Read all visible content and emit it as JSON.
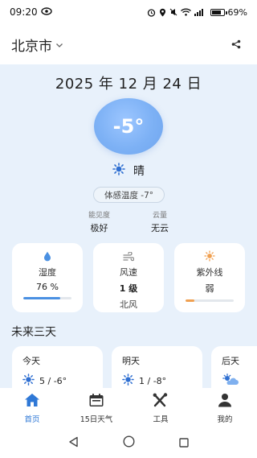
{
  "status_bar": {
    "time": "09:20",
    "battery": "69%",
    "battery_level": 0.69
  },
  "header": {
    "city": "北京市"
  },
  "weather": {
    "date": "2025 年 12 月 24 日",
    "temperature": "-5°",
    "condition": "晴",
    "feels_like": "体感温度 -7°",
    "stats": [
      {
        "label": "能见度",
        "value": "极好"
      },
      {
        "label": "云量",
        "value": "无云"
      }
    ]
  },
  "cards": {
    "humidity": {
      "title": "湿度",
      "value": "76 %",
      "level": 0.76,
      "color": "#4a90e2"
    },
    "wind": {
      "title": "风速",
      "value": "1 级",
      "direction": "北风"
    },
    "uv": {
      "title": "紫外线",
      "value": "弱",
      "level": 0.18,
      "color": "#f0a050"
    }
  },
  "forecast": {
    "title": "未来三天",
    "days": [
      {
        "day": "今天",
        "temp": "5 / -6°",
        "icon": "sun-icon"
      },
      {
        "day": "明天",
        "temp": "1 / -8°",
        "icon": "sun-icon"
      },
      {
        "day": "后天",
        "temp": "",
        "icon": "partly-cloudy-icon"
      }
    ]
  },
  "nav": {
    "items": [
      {
        "label": "首页",
        "icon": "home-icon",
        "active": true
      },
      {
        "label": "15日天气",
        "icon": "calendar-icon",
        "active": false
      },
      {
        "label": "工具",
        "icon": "tools-icon",
        "active": false
      },
      {
        "label": "我的",
        "icon": "user-icon",
        "active": false
      }
    ]
  },
  "colors": {
    "accent": "#2f78d6",
    "sun": "#2f6fd1",
    "background": "#e8f1fb"
  }
}
